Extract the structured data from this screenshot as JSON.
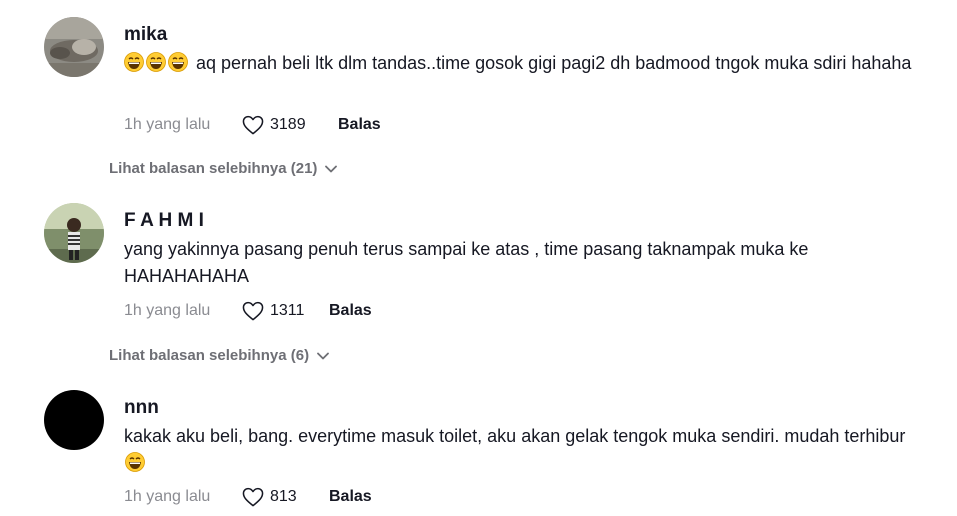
{
  "comments": [
    {
      "username": "mika",
      "text": "aq pernah beli ltk dlm tandas..time gosok gigi pagi2 dh badmood tngok muka sdiri hahaha",
      "leading_emojis": [
        "laughing-face-icon",
        "laughing-face-icon",
        "laughing-face-icon"
      ],
      "time": "1h yang lalu",
      "likes": "3189",
      "reply_label": "Balas",
      "view_replies": "Lihat balasan selebihnya (21)"
    },
    {
      "username": "F A H M I",
      "text": "yang yakinnya pasang penuh terus sampai ke atas , time pasang taknampak muka ke HAHAHAHAHA",
      "time": "1h yang lalu",
      "likes": "1311",
      "reply_label": "Balas",
      "view_replies": "Lihat balasan selebihnya (6)"
    },
    {
      "username": "nnn",
      "text": "kakak aku beli, bang. everytime masuk toilet, aku akan gelak tengok muka sendiri. mudah terhibur",
      "trailing_emojis": [
        "laughing-face-icon"
      ],
      "time": "1h yang lalu",
      "likes": "813",
      "reply_label": "Balas"
    }
  ],
  "colors": {
    "text": "#161823",
    "muted": "#8a8b91",
    "view_replies": "#6e6f75"
  }
}
